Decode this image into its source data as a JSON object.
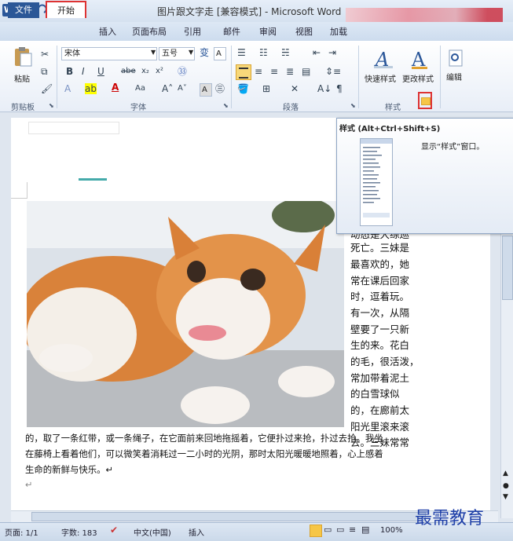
{
  "window": {
    "title": "图片跟文字走 [兼容模式] - Microsoft Word"
  },
  "tabs": {
    "file": "文件",
    "home": "开始",
    "insert": "插入",
    "layout": "页面布局",
    "references": "引用",
    "mailings": "邮件",
    "review": "审阅",
    "view": "视图",
    "addins": "加载"
  },
  "ribbon": {
    "paste": "粘贴",
    "font_name": "宋体",
    "font_size": "五号",
    "quick_styles": "快速样式",
    "change_styles": "更改样式",
    "edit": "编辑",
    "groups": {
      "clipboard": "剪贴板",
      "font": "字体",
      "paragraph": "段落",
      "styles": "样式"
    }
  },
  "tooltip": {
    "title": "样式 (Alt+Ctrl+Shift+S)",
    "description": "显示“样式”窗口。"
  },
  "document": {
    "column_lines": [
      "动态是大综巡",
      "死亡。三妹是",
      "最喜欢的，她",
      "常在课后回家",
      "时，逗着玩。",
      "有一次，从隔",
      "壁要了一只新",
      "生的来。花白",
      "的毛，很活泼，",
      "常加带着泥土",
      "的白雪球似",
      "的，在廊前太",
      "阳光里滚来滚",
      "去。三妹常常"
    ],
    "body_lines": [
      "的，取了一条红带，或一条绳子，在它面前来回地拖摇着，它便扑过来抢，扑过去抢。我坐",
      "在藤椅上看着他们，可以微笑着消耗过一二小时的光阴，那时太阳光暖暖地照着，心上感着",
      "生命的新鲜与快乐。↵",
      "↵"
    ]
  },
  "statusbar": {
    "page": "页面: 1/1",
    "words": "字数: 183",
    "language": "中文(中国)",
    "mode": "插入",
    "zoom": "100%"
  },
  "watermark": "最需教育"
}
